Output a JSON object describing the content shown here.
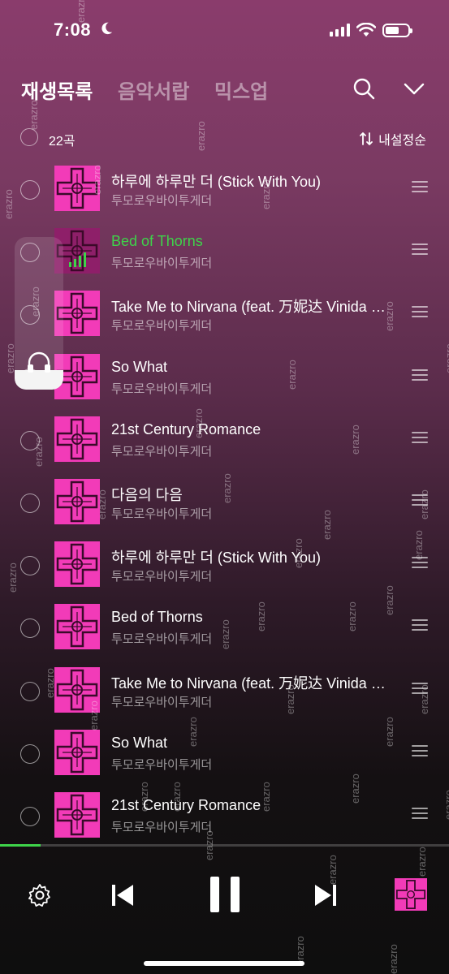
{
  "status_bar": {
    "time": "7:08"
  },
  "header": {
    "tabs": [
      {
        "label": "재생목록",
        "active": true
      },
      {
        "label": "음악서랍",
        "active": false
      },
      {
        "label": "믹스업",
        "active": false
      }
    ]
  },
  "list_header": {
    "count": "22곡",
    "sort_label": "내설정순"
  },
  "tracks": [
    {
      "title": "하루에 하루만 더 (Stick With You)",
      "artist": "투모로우바이투게더",
      "playing": false
    },
    {
      "title": "Bed of Thorns",
      "artist": "투모로우바이투게더",
      "playing": true
    },
    {
      "title": "Take Me to Nirvana (feat. 万妮达 Vinida Weng)",
      "artist": "투모로우바이투게더",
      "playing": false
    },
    {
      "title": "So What",
      "artist": "투모로우바이투게더",
      "playing": false
    },
    {
      "title": "21st Century Romance",
      "artist": "투모로우바이투게더",
      "playing": false
    },
    {
      "title": "다음의 다음",
      "artist": "투모로우바이투게더",
      "playing": false
    },
    {
      "title": "하루에 하루만 더 (Stick With You)",
      "artist": "투모로우바이투게더",
      "playing": false
    },
    {
      "title": "Bed of Thorns",
      "artist": "투모로우바이투게더",
      "playing": false
    },
    {
      "title": "Take Me to Nirvana (feat. 万妮达 Vinida Weng)",
      "artist": "투모로우바이투게더",
      "playing": false
    },
    {
      "title": "So What",
      "artist": "투모로우바이투게더",
      "playing": false
    },
    {
      "title": "21st Century Romance",
      "artist": "투모로우바이투게더",
      "playing": false
    }
  ],
  "playback": {
    "progress": 0.09
  },
  "watermark": "erazro",
  "colors": {
    "accent": "#3ed34a",
    "album_art": "#f23bb8"
  },
  "icons": [
    "moon-icon",
    "signal-icon",
    "wifi-icon",
    "battery-icon",
    "search-icon",
    "chevron-down-icon",
    "sort-icon",
    "drag-handle-icon",
    "headphone-icon",
    "gear-icon",
    "previous-icon",
    "pause-icon",
    "next-icon"
  ]
}
